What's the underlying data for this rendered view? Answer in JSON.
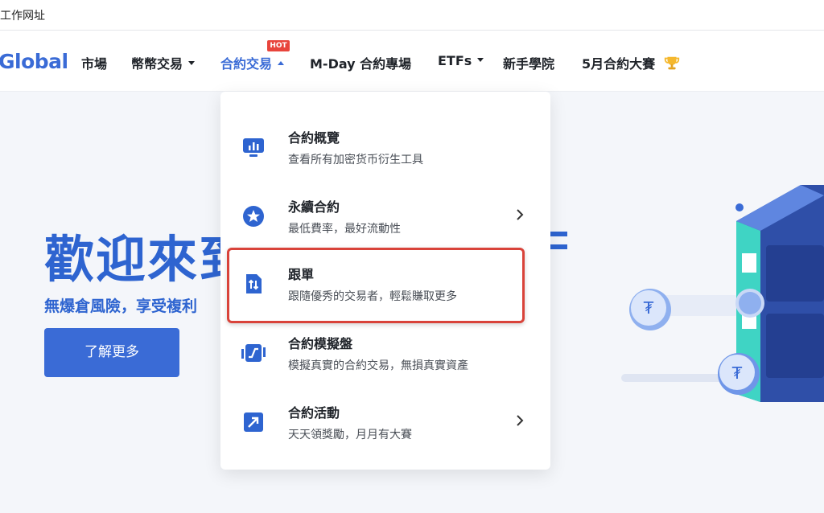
{
  "bookmarks": {
    "label": "工作网址"
  },
  "nav": {
    "logo": "Global",
    "items": [
      {
        "label": "市場"
      },
      {
        "label": "幣幣交易"
      },
      {
        "label": "合約交易",
        "badge": "HOT"
      },
      {
        "label": "M-Day 合約專場"
      },
      {
        "label": "ETFs"
      },
      {
        "label": "新手學院"
      },
      {
        "label": "5月合約大賽"
      }
    ]
  },
  "hero": {
    "title": "歡迎來到",
    "subtitle": "無爆倉風險，享受複利",
    "button": "了解更多"
  },
  "dropdown": {
    "items": [
      {
        "title": "合約概覽",
        "desc": "查看所有加密货币衍生工具",
        "icon": "chart-monitor-icon",
        "has_submenu": false
      },
      {
        "title": "永續合約",
        "desc": "最低費率，最好流動性",
        "icon": "star-circle-icon",
        "has_submenu": true
      },
      {
        "title": "跟單",
        "desc": "跟隨優秀的交易者，輕鬆賺取更多",
        "icon": "swap-doc-icon",
        "has_submenu": false
      },
      {
        "title": "合約模擬盤",
        "desc": "模擬真實的合約交易，無損真實資產",
        "icon": "simulation-icon",
        "has_submenu": false
      },
      {
        "title": "合約活動",
        "desc": "天天領獎勵，月月有大賽",
        "icon": "trend-arrow-icon",
        "has_submenu": true
      }
    ]
  },
  "colors": {
    "brand": "#3a6bd6",
    "highlight": "#d9433a",
    "hot": "#e8453c"
  }
}
